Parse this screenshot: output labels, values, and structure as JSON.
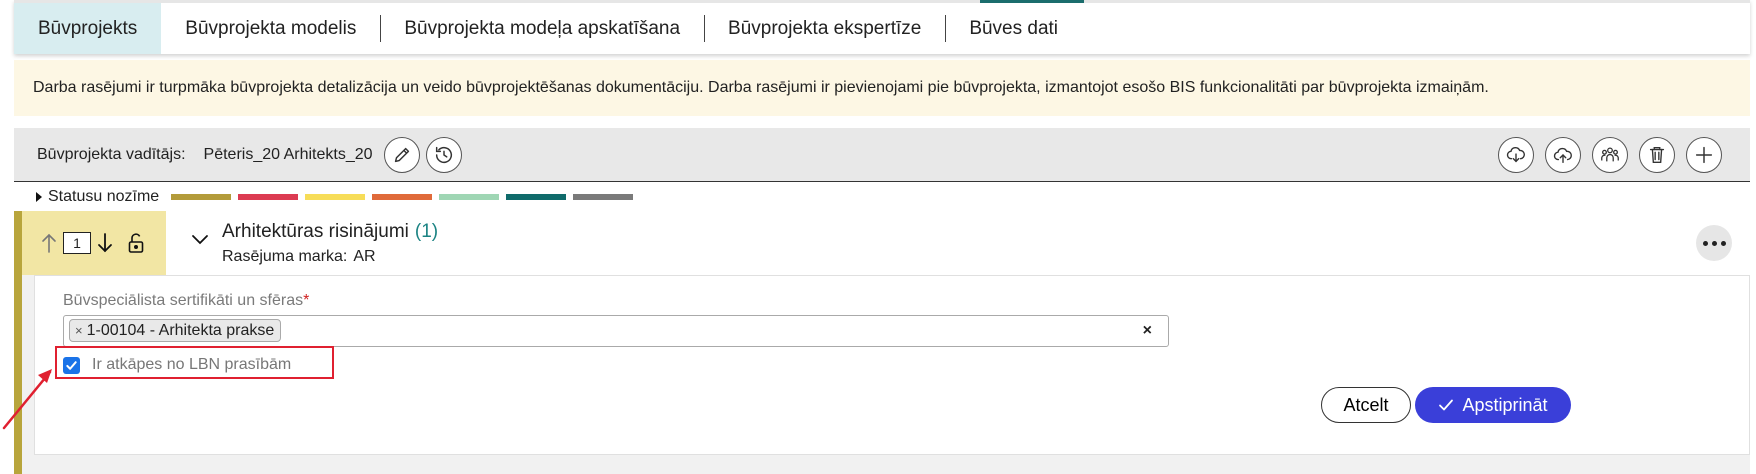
{
  "tabs": [
    {
      "label": "Būvprojekts",
      "active": true
    },
    {
      "label": "Būvprojekta modelis",
      "active": false
    },
    {
      "label": "Būvprojekta modeļa apskatīšana",
      "active": false
    },
    {
      "label": "Būvprojekta ekspertīze",
      "active": false
    },
    {
      "label": "Būves dati",
      "active": false
    }
  ],
  "info_text": "Darba rasējumi ir turpmāka būvprojekta detalizācija un veido būvprojektēšanas dokumentāciju. Darba rasējumi ir pievienojami pie būvprojekta, izmantojot esošo BIS funkcionalitāti par būvprojekta izmaiņām.",
  "leader": {
    "label": "Būvprojekta vadītājs:",
    "name": "Pēteris_20 Arhitekts_20"
  },
  "legend": {
    "label": "Statusu nozīme",
    "colors": [
      "#b39b3a",
      "#dc3b52",
      "#f7dd58",
      "#e06a3a",
      "#9fd6b4",
      "#0f6b6b",
      "#7a7a7a"
    ]
  },
  "section": {
    "order": "1",
    "title": "Arhitektūras risinājumi",
    "count": "(1)",
    "sub_label": "Rasējuma marka:",
    "sub_value": "AR"
  },
  "form": {
    "field_label": "Būvspeciālista sertifikāti un sfēras",
    "required_mark": "*",
    "chip_remove": "×",
    "chip": "1-00104 - Arhitekta prakse",
    "clear": "×",
    "checkbox_label": "Ir atkāpes no LBN prasībām",
    "checkbox_checked": true,
    "cancel_label": "Atcelt",
    "confirm_label": "Apstiprināt"
  },
  "colors": {
    "accent": "#3a3fd9",
    "teal": "#1b6d6d",
    "highlight": "#e02030",
    "stripe": "#b8a53c"
  }
}
